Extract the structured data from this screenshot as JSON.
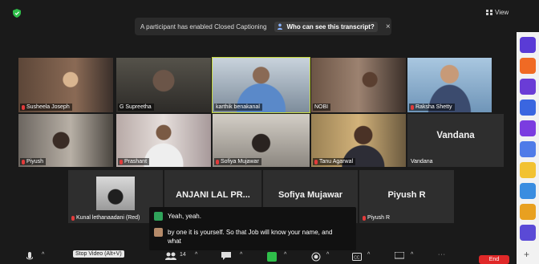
{
  "caption_notice": {
    "message": "A participant has enabled Closed Captioning",
    "link": "Who can see this transcript?",
    "close": "×"
  },
  "view": {
    "label": "View"
  },
  "row1": [
    {
      "name": "Susheela Joseph"
    },
    {
      "name": "G Supreetha"
    },
    {
      "name": "karthik benakanal"
    },
    {
      "name": "NOBI"
    },
    {
      "name": "Raksha Shetty"
    }
  ],
  "row2": [
    {
      "name": "Piyush"
    },
    {
      "name": "Prashant"
    },
    {
      "name": "Sofiya Mujawar"
    },
    {
      "name": "Tanu Agarwal"
    },
    {
      "name": "Vandana",
      "big": "Vandana"
    }
  ],
  "row3": [
    {
      "name": "Kunal lethanaadani (Red)"
    },
    {
      "name": "ANJANI LAL PRADHAN",
      "big": "ANJANI LAL PR..."
    },
    {
      "name": "Sofiya Mujawar",
      "big": "Sofiya Mujawar"
    },
    {
      "name": "Piyush R",
      "big": "Piyush R"
    }
  ],
  "captions": {
    "line1": "Yeah, yeah.",
    "line2": "by one it is yourself. So that Job will know your name, and what"
  },
  "toolbar": {
    "stop_video_tooltip": "Stop Video (Alt+V)",
    "participants_count": "14",
    "end": "End"
  },
  "colors": {
    "active_speaker": "#c6d93a",
    "end_button": "#e02828",
    "muted_mic": "#e23b3b"
  }
}
